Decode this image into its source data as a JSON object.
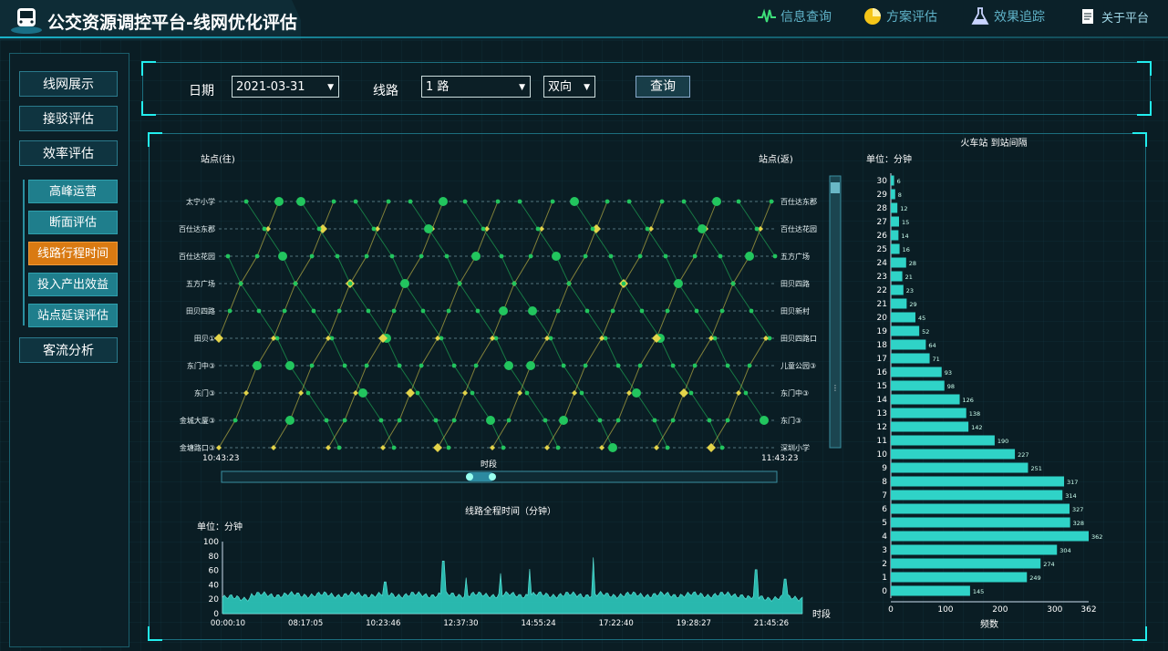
{
  "app": {
    "title": "公交资源调控平台-线网优化评估"
  },
  "topnav": [
    {
      "label": "信息查询",
      "icon": "pulse-icon"
    },
    {
      "label": "方案评估",
      "icon": "pie-chart-icon"
    },
    {
      "label": "效果追踪",
      "icon": "flask-icon"
    },
    {
      "label": "关于平台",
      "icon": "document-icon"
    }
  ],
  "sidebar": {
    "items": [
      "线网展示",
      "接驳评估",
      "效率评估"
    ],
    "subitems": [
      "高峰运营",
      "断面评估",
      "线路行程时间",
      "投入产出效益",
      "站点延误评估"
    ],
    "active_sub": "线路行程时间",
    "last": "客流分析"
  },
  "query": {
    "date_label": "日期",
    "date_value": "2021-03-31",
    "line_label": "线路",
    "line_value": "1 路",
    "direction_value": "双向",
    "submit_label": "查询"
  },
  "colors": {
    "accent": "#2ee0e0",
    "bar": "#2fd3c7",
    "green": "#22c55e",
    "yellow": "#e3d44a",
    "active": "#d97a12"
  },
  "chart_data": [
    {
      "type": "scatter",
      "left_axis_title": "站点(往)",
      "right_axis_title": "站点(返)",
      "stations_left": [
        "太宁小学",
        "百仕达东郡",
        "百仕达花园",
        "五方广场",
        "田贝四路",
        "田贝①",
        "东门中③",
        "东门③",
        "金城大厦③",
        "金塘路口③"
      ],
      "stations_right": [
        "百仕达东郡",
        "百仕达花园",
        "五方广场",
        "田贝四路",
        "田贝新村",
        "田贝四路口",
        "儿童公园③",
        "东门中③",
        "东门③",
        "深圳小学"
      ],
      "x_start": "10:43:23",
      "x_end": "11:43:23",
      "xlabel": "时段"
    },
    {
      "type": "area",
      "title": "线路全程时间（分钟）",
      "unit_label": "单位：分钟",
      "xlabel": "时段",
      "ylim": [
        0,
        100
      ],
      "yticks": [
        0,
        20,
        40,
        60,
        80,
        100
      ],
      "xticks": [
        "00:00:10",
        "08:17:05",
        "10:23:46",
        "12:37:30",
        "14:55:24",
        "17:22:40",
        "19:28:27",
        "21:45:26"
      ],
      "baseline": 22,
      "spikes": [
        [
          0.28,
          44
        ],
        [
          0.38,
          73
        ],
        [
          0.42,
          50
        ],
        [
          0.48,
          56
        ],
        [
          0.53,
          62
        ],
        [
          0.64,
          78
        ],
        [
          0.92,
          61
        ],
        [
          0.97,
          48
        ]
      ]
    },
    {
      "type": "bar",
      "title": "火车站 到站间隔",
      "unit_label": "单位：分钟",
      "xlabel": "频数",
      "xlim": [
        0,
        362
      ],
      "xticks": [
        0,
        100,
        200,
        300,
        362
      ],
      "categories": [
        30,
        29,
        28,
        27,
        26,
        25,
        24,
        23,
        22,
        21,
        20,
        19,
        18,
        17,
        16,
        15,
        14,
        13,
        12,
        11,
        10,
        9,
        8,
        7,
        6,
        5,
        4,
        3,
        2,
        1,
        0
      ],
      "values": [
        6,
        8,
        12,
        15,
        14,
        16,
        28,
        21,
        23,
        29,
        45,
        52,
        64,
        71,
        93,
        98,
        126,
        138,
        142,
        190,
        227,
        251,
        317,
        314,
        327,
        328,
        362,
        304,
        274,
        249,
        145
      ]
    }
  ]
}
